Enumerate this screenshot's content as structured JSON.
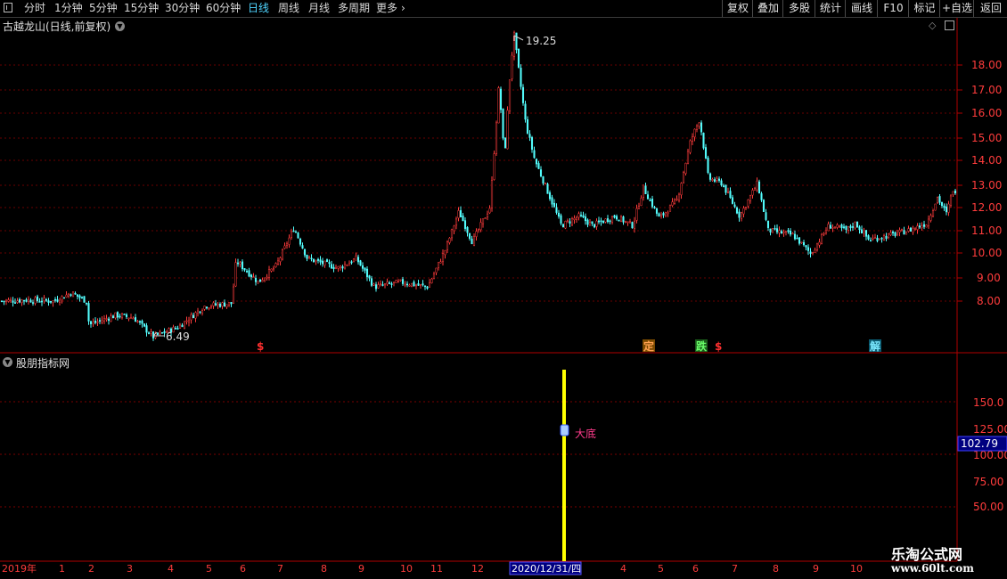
{
  "toolbar": {
    "periods": [
      "分时",
      "1分钟",
      "5分钟",
      "15分钟",
      "30分钟",
      "60分钟",
      "日线",
      "周线",
      "月线",
      "多周期",
      "更多"
    ],
    "active_period": "日线",
    "right_buttons": [
      "复权",
      "叠加",
      "多股",
      "统计",
      "画线",
      "F10",
      "+自选",
      "返回"
    ],
    "mark_button": "标记"
  },
  "main_chart": {
    "title": "古越龙山(日线,前复权)",
    "high_label": "19.25",
    "low_label": "6.49",
    "y_ticks": [
      "18.00",
      "17.00",
      "16.00",
      "15.00",
      "14.00",
      "13.00",
      "12.00",
      "11.00",
      "10.00",
      "9.00",
      "8.00"
    ],
    "signals": [
      {
        "text": "$",
        "color": "#ff3030"
      },
      {
        "text": "定",
        "color": "#ff8a30"
      },
      {
        "text": "跌",
        "color": "#30d030"
      },
      {
        "text": "$",
        "color": "#ff3030"
      },
      {
        "text": "解",
        "color": "#30c0ff"
      }
    ]
  },
  "indicator": {
    "title": "股朋指标网",
    "y_ticks": [
      "125.00",
      "100.00",
      "75.00",
      "50.00",
      "150.0"
    ],
    "current_value": "102.79",
    "signal_label": "大底"
  },
  "time_axis": {
    "year_label": "2019年",
    "months": [
      "1",
      "2",
      "3",
      "4",
      "5",
      "6",
      "7",
      "8",
      "9",
      "10",
      "11",
      "12",
      "4",
      "5",
      "6",
      "7",
      "8",
      "9",
      "10"
    ],
    "cursor_date": "2020/12/31/四"
  },
  "watermark": {
    "line1": "乐淘公式网",
    "line2": "www.60lt.com"
  },
  "colors": {
    "up": "#ff3c3c",
    "down": "#54ffff",
    "axis": "#b00000",
    "cursor_bar": "#ffff00",
    "value_box": "#000080"
  }
}
